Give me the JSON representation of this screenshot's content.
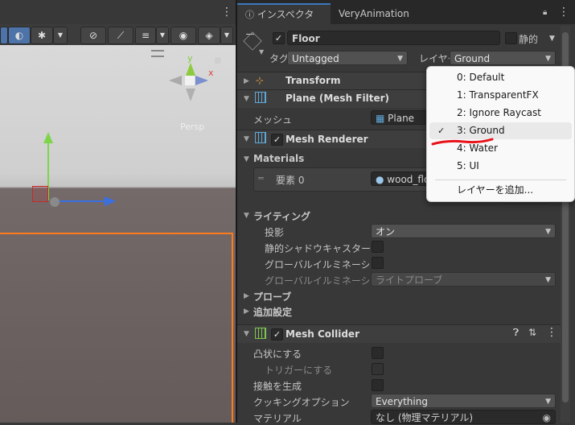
{
  "scene": {
    "persp_label": "Persp",
    "axes": {
      "y": "y",
      "x": "x"
    }
  },
  "tabs": {
    "inspector": "インスペクター",
    "very_animation": "VeryAnimation"
  },
  "object": {
    "name": "Floor",
    "active": true,
    "static_label": "静的",
    "tag_label": "タグ",
    "tag_value": "Untagged",
    "layer_label": "レイヤー",
    "layer_value": "Ground"
  },
  "components": {
    "transform": {
      "title": "Transform"
    },
    "mesh_filter": {
      "title": "Plane (Mesh Filter)",
      "mesh_label": "メッシュ",
      "mesh_value": "Plane"
    },
    "mesh_renderer": {
      "title": "Mesh Renderer",
      "materials_label": "Materials",
      "element_label": "要素 0",
      "element_value": "wood_flo",
      "lighting_label": "ライティング",
      "cast_shadows_label": "投影",
      "cast_shadows_value": "オン",
      "static_shadow_caster_label": "静的シャドウキャスター",
      "contribute_gi_label": "グローバルイルミネーションに",
      "receive_gi_label": "グローバルイルミネーションを受",
      "receive_gi_value": "ライトプローブ",
      "probes_label": "プローブ",
      "additional_label": "追加設定"
    },
    "mesh_collider": {
      "title": "Mesh Collider",
      "convex_label": "凸状にする",
      "trigger_label": "トリガーにする",
      "contacts_label": "接触を生成",
      "cooking_label": "クッキングオプション",
      "cooking_value": "Everything",
      "material_label": "マテリアル",
      "material_value": "なし (物理マテリアル)"
    }
  },
  "layer_menu": {
    "items": [
      "0: Default",
      "1: TransparentFX",
      "2: Ignore Raycast",
      "3: Ground",
      "4: Water",
      "5: UI"
    ],
    "selected_index": 3,
    "add_layer": "レイヤーを追加..."
  },
  "colors": {
    "accent": "#3a79bb",
    "selection_outline": "#ff7a1a",
    "annotation": "#e8131b"
  }
}
